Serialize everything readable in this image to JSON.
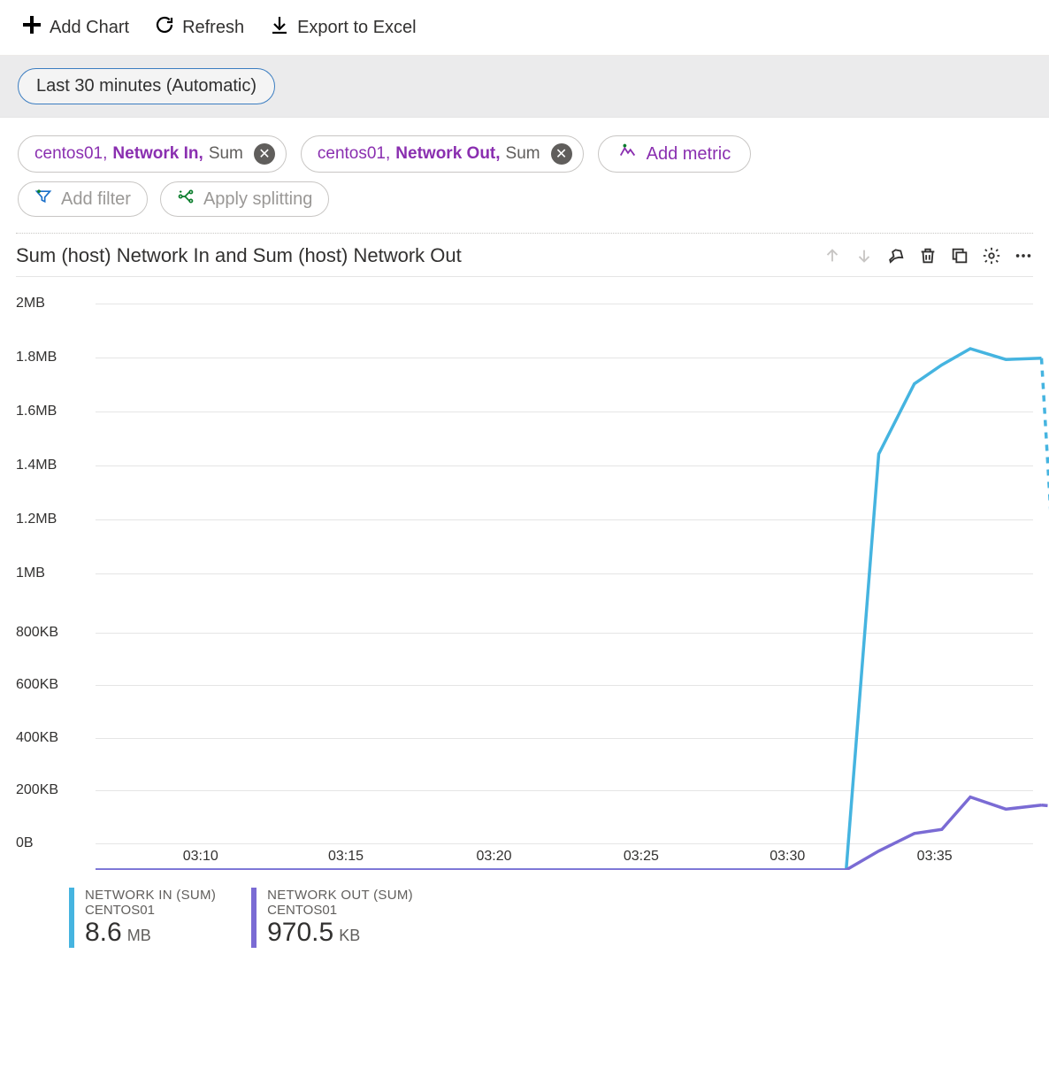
{
  "toolbar": {
    "add_chart": "Add Chart",
    "refresh": "Refresh",
    "export": "Export to Excel"
  },
  "timerange": {
    "label": "Last 30 minutes (Automatic)"
  },
  "metrics_selected": [
    {
      "resource": "centos01,",
      "metric": "Network In,",
      "agg": "Sum"
    },
    {
      "resource": "centos01,",
      "metric": "Network Out,",
      "agg": "Sum"
    }
  ],
  "add_metric_label": "Add metric",
  "add_filter_label": "Add filter",
  "apply_splitting_label": "Apply splitting",
  "chart": {
    "title": "Sum (host) Network In and Sum (host) Network Out",
    "color_in": "#45b4e0",
    "color_out": "#7a6bd4"
  },
  "legend": [
    {
      "name": "NETWORK IN (SUM)",
      "sub": "CENTOS01",
      "value": "8.6",
      "unit": "MB",
      "color": "#45b4e0"
    },
    {
      "name": "NETWORK OUT (SUM)",
      "sub": "CENTOS01",
      "value": "970.5",
      "unit": "KB",
      "color": "#7a6bd4"
    }
  ],
  "chart_data": {
    "type": "line",
    "xlabel": "",
    "ylabel": "",
    "ylim": [
      0,
      2097152
    ],
    "y_ticks": [
      "0B",
      "200KB",
      "400KB",
      "600KB",
      "800KB",
      "1MB",
      "1.2MB",
      "1.4MB",
      "1.6MB",
      "1.8MB",
      "2MB"
    ],
    "y_tick_values": [
      0,
      204800,
      409600,
      614400,
      819200,
      1048576,
      1258291,
      1468006,
      1677722,
      1887437,
      2097152
    ],
    "x_ticks": [
      "03:10",
      "03:15",
      "03:20",
      "03:25",
      "03:30",
      "03:35"
    ],
    "x_tick_positions": [
      0.112,
      0.267,
      0.425,
      0.582,
      0.738,
      0.895
    ],
    "x_range_frac": [
      0.0,
      0.97
    ],
    "series": [
      {
        "name": "Network In (Sum)",
        "color": "#45b4e0",
        "solid_x_frac": [
          0.0,
          0.738,
          0.77,
          0.805,
          0.832,
          0.86,
          0.895,
          0.93
        ],
        "solid_y_bytes": [
          0,
          0,
          1540000,
          1800000,
          1870000,
          1930000,
          1890000,
          1895000
        ],
        "dashed_x_frac": [
          0.93,
          0.96
        ],
        "dashed_y_bytes": [
          1895000,
          0
        ]
      },
      {
        "name": "Network Out (Sum)",
        "color": "#7a6bd4",
        "solid_x_frac": [
          0.0,
          0.738,
          0.77,
          0.805,
          0.832,
          0.86,
          0.895,
          0.93
        ],
        "solid_y_bytes": [
          0,
          0,
          70000,
          135000,
          150000,
          270000,
          225000,
          240000
        ],
        "dashed_x_frac": [
          0.93,
          0.96,
          0.97
        ],
        "dashed_y_bytes": [
          240000,
          230000,
          0
        ]
      }
    ]
  }
}
